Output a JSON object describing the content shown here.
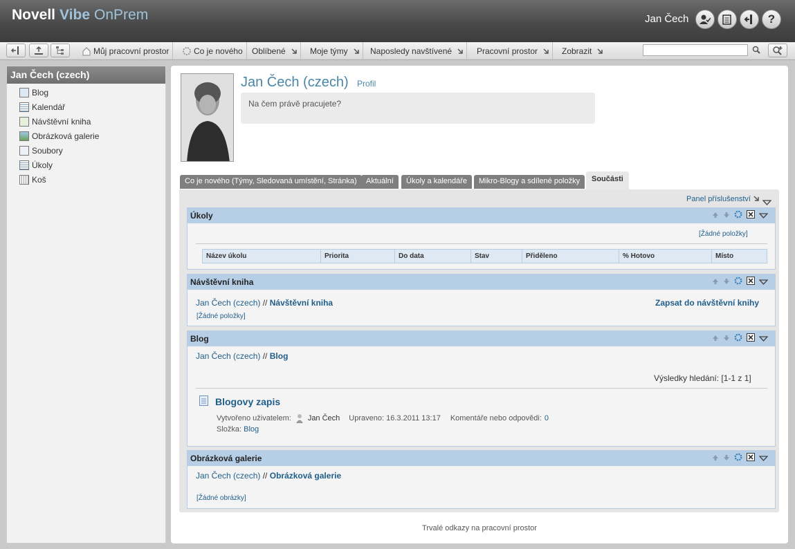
{
  "header": {
    "brand_novell": "Novell",
    "brand_vibe": "Vibe",
    "brand_onprem": "OnPrem",
    "user": "Jan Čech",
    "icons": [
      "user-settings-icon",
      "notes-icon",
      "logout-icon",
      "help-icon"
    ]
  },
  "toolbar": {
    "items": [
      "Můj pracovní prostor",
      "Co je nového",
      "Oblíbené",
      "Moje týmy",
      "Naposledy navštívené",
      "Pracovní prostor",
      "Zobrazit"
    ],
    "search_value": ""
  },
  "sidebar": {
    "title": "Jan Čech (czech)",
    "items": [
      "Blog",
      "Kalendář",
      "Návštěvní kniha",
      "Obrázková galerie",
      "Soubory",
      "Úkoly",
      "Koš"
    ]
  },
  "profile": {
    "name": "Jan Čech (czech)",
    "profile_link": "Profil",
    "status_prompt": "Na čem právě pracujete?"
  },
  "tabs": [
    "Co je nového (Týmy, Sledovaná umístění, Stránka)",
    "Aktuální",
    "Úkoly a kalendáře",
    "Mikro-Blogy a sdílené položky",
    "Součásti"
  ],
  "accessory_panel": "Panel příslušenství",
  "tasks": {
    "title": "Úkoly",
    "empty": "[Žádné položky]",
    "columns": [
      "Název úkolu",
      "Priorita",
      "Do data",
      "Stav",
      "Přiděleno",
      "% Hotovo",
      "Místo"
    ]
  },
  "guestbook": {
    "title": "Návštěvní kniha",
    "path_user": "Jan Čech (czech)",
    "sep": "//",
    "path_target": "Návštěvní kniha",
    "sign": "Zapsat do návštěvní knihy",
    "empty": "[Žádné položky]"
  },
  "blog": {
    "title": "Blog",
    "path_user": "Jan Čech (czech)",
    "sep": "//",
    "path_target": "Blog",
    "results": "Výsledky hledání: [1-1 z 1]",
    "entry_title": "Blogovy zapis",
    "created_by_label": "Vytvořeno uživatelem:",
    "author": "Jan Čech",
    "modified": "Upraveno: 16.3.2011 13:17",
    "comments_label": "Komentáře nebo odpovědi:",
    "comments_count": "0",
    "folder_label": "Složka:",
    "folder": "Blog"
  },
  "gallery": {
    "title": "Obrázková galerie",
    "path_user": "Jan Čech (czech)",
    "sep": "//",
    "path_target": "Obrázková galerie",
    "empty": "[Žádné obrázky]"
  },
  "footer": "Trvalé odkazy na pracovní prostor"
}
